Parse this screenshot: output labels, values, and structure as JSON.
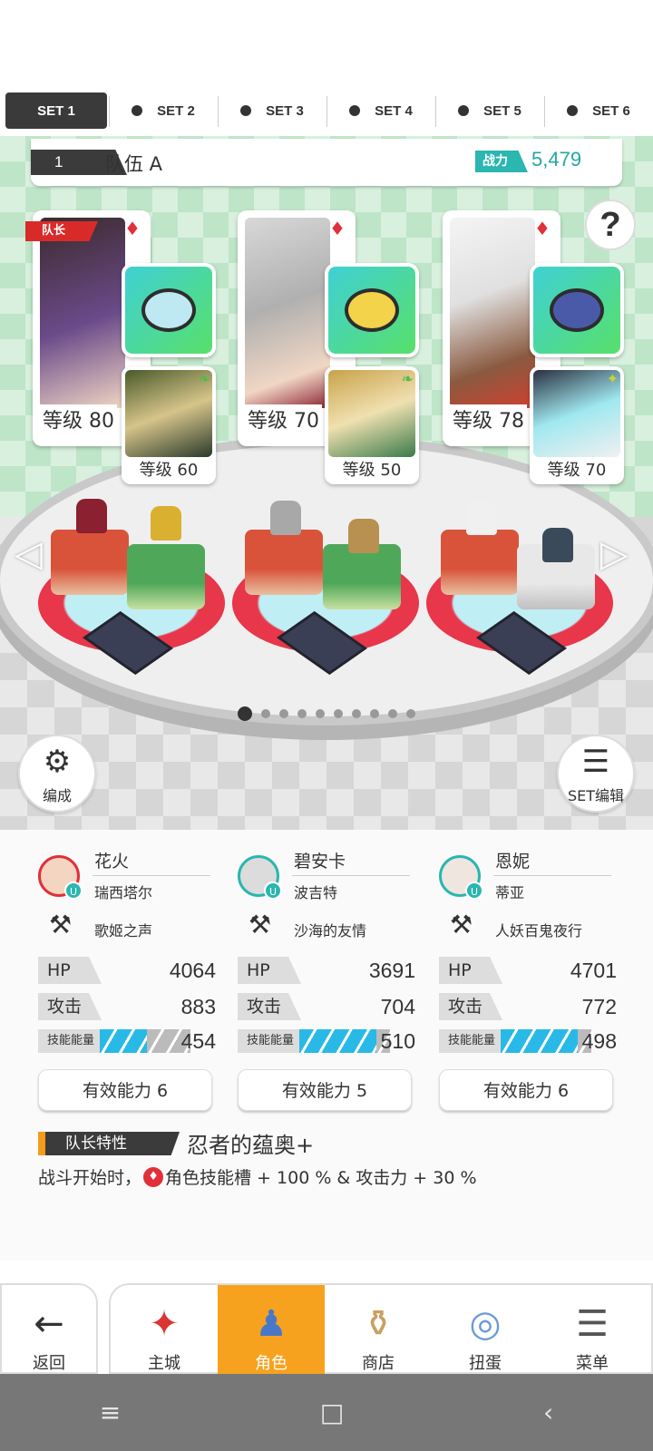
{
  "tabs": [
    {
      "label": "SET 1",
      "active": true
    },
    {
      "label": "SET 2"
    },
    {
      "label": "SET 3"
    },
    {
      "label": "SET 4"
    },
    {
      "label": "SET 5"
    },
    {
      "label": "SET 6"
    }
  ],
  "team": {
    "number": "1",
    "name": "队伍 A",
    "power_label": "战力",
    "power_value": "5,479"
  },
  "help_icon": "?",
  "leader_badge": "队长",
  "slots": [
    {
      "level": "等级 80",
      "sub_level": "等级 60",
      "gem_color": "#bfe9f2"
    },
    {
      "level": "等级 70",
      "sub_level": "等级 50",
      "gem_color": "#f2d34a"
    },
    {
      "level": "等级 78",
      "sub_level": "等级 70",
      "gem_color": "#4b5aa8"
    }
  ],
  "page_dots": {
    "count": 10,
    "active": 0
  },
  "buttons": {
    "edit": "编成",
    "set_edit": "SET编辑"
  },
  "characters": [
    {
      "name": "花火",
      "title": "瑞西塔尔",
      "weapon": "歌姬之声",
      "hp": "4064",
      "atk": "883",
      "energy": "454",
      "energy_fill": 0.52,
      "ability": "有效能力 6"
    },
    {
      "name": "碧安卡",
      "title": "波吉特",
      "weapon": "沙海的友情",
      "hp": "3691",
      "atk": "704",
      "energy": "510",
      "energy_fill": 0.85,
      "ability": "有效能力 5"
    },
    {
      "name": "恩妮",
      "title": "蒂亚",
      "weapon": "人妖百鬼夜行",
      "hp": "4701",
      "atk": "772",
      "energy": "498",
      "energy_fill": 0.85,
      "ability": "有效能力 6"
    }
  ],
  "labels": {
    "hp": "HP",
    "atk": "攻击",
    "energy": "技能能量"
  },
  "leader": {
    "tag": "队长特性",
    "name": "忍者的蕴奥+",
    "desc_prefix": "战斗开始时，",
    "desc_suffix": "角色技能槽 + 100 % & 攻击力 + 30 %"
  },
  "nav": {
    "back": "返回",
    "items": [
      {
        "label": "主城"
      },
      {
        "label": "角色",
        "active": true
      },
      {
        "label": "商店"
      },
      {
        "label": "扭蛋"
      },
      {
        "label": "菜单"
      }
    ]
  },
  "sysbar": {
    "menu": "≡",
    "home": "□",
    "back": "‹"
  }
}
